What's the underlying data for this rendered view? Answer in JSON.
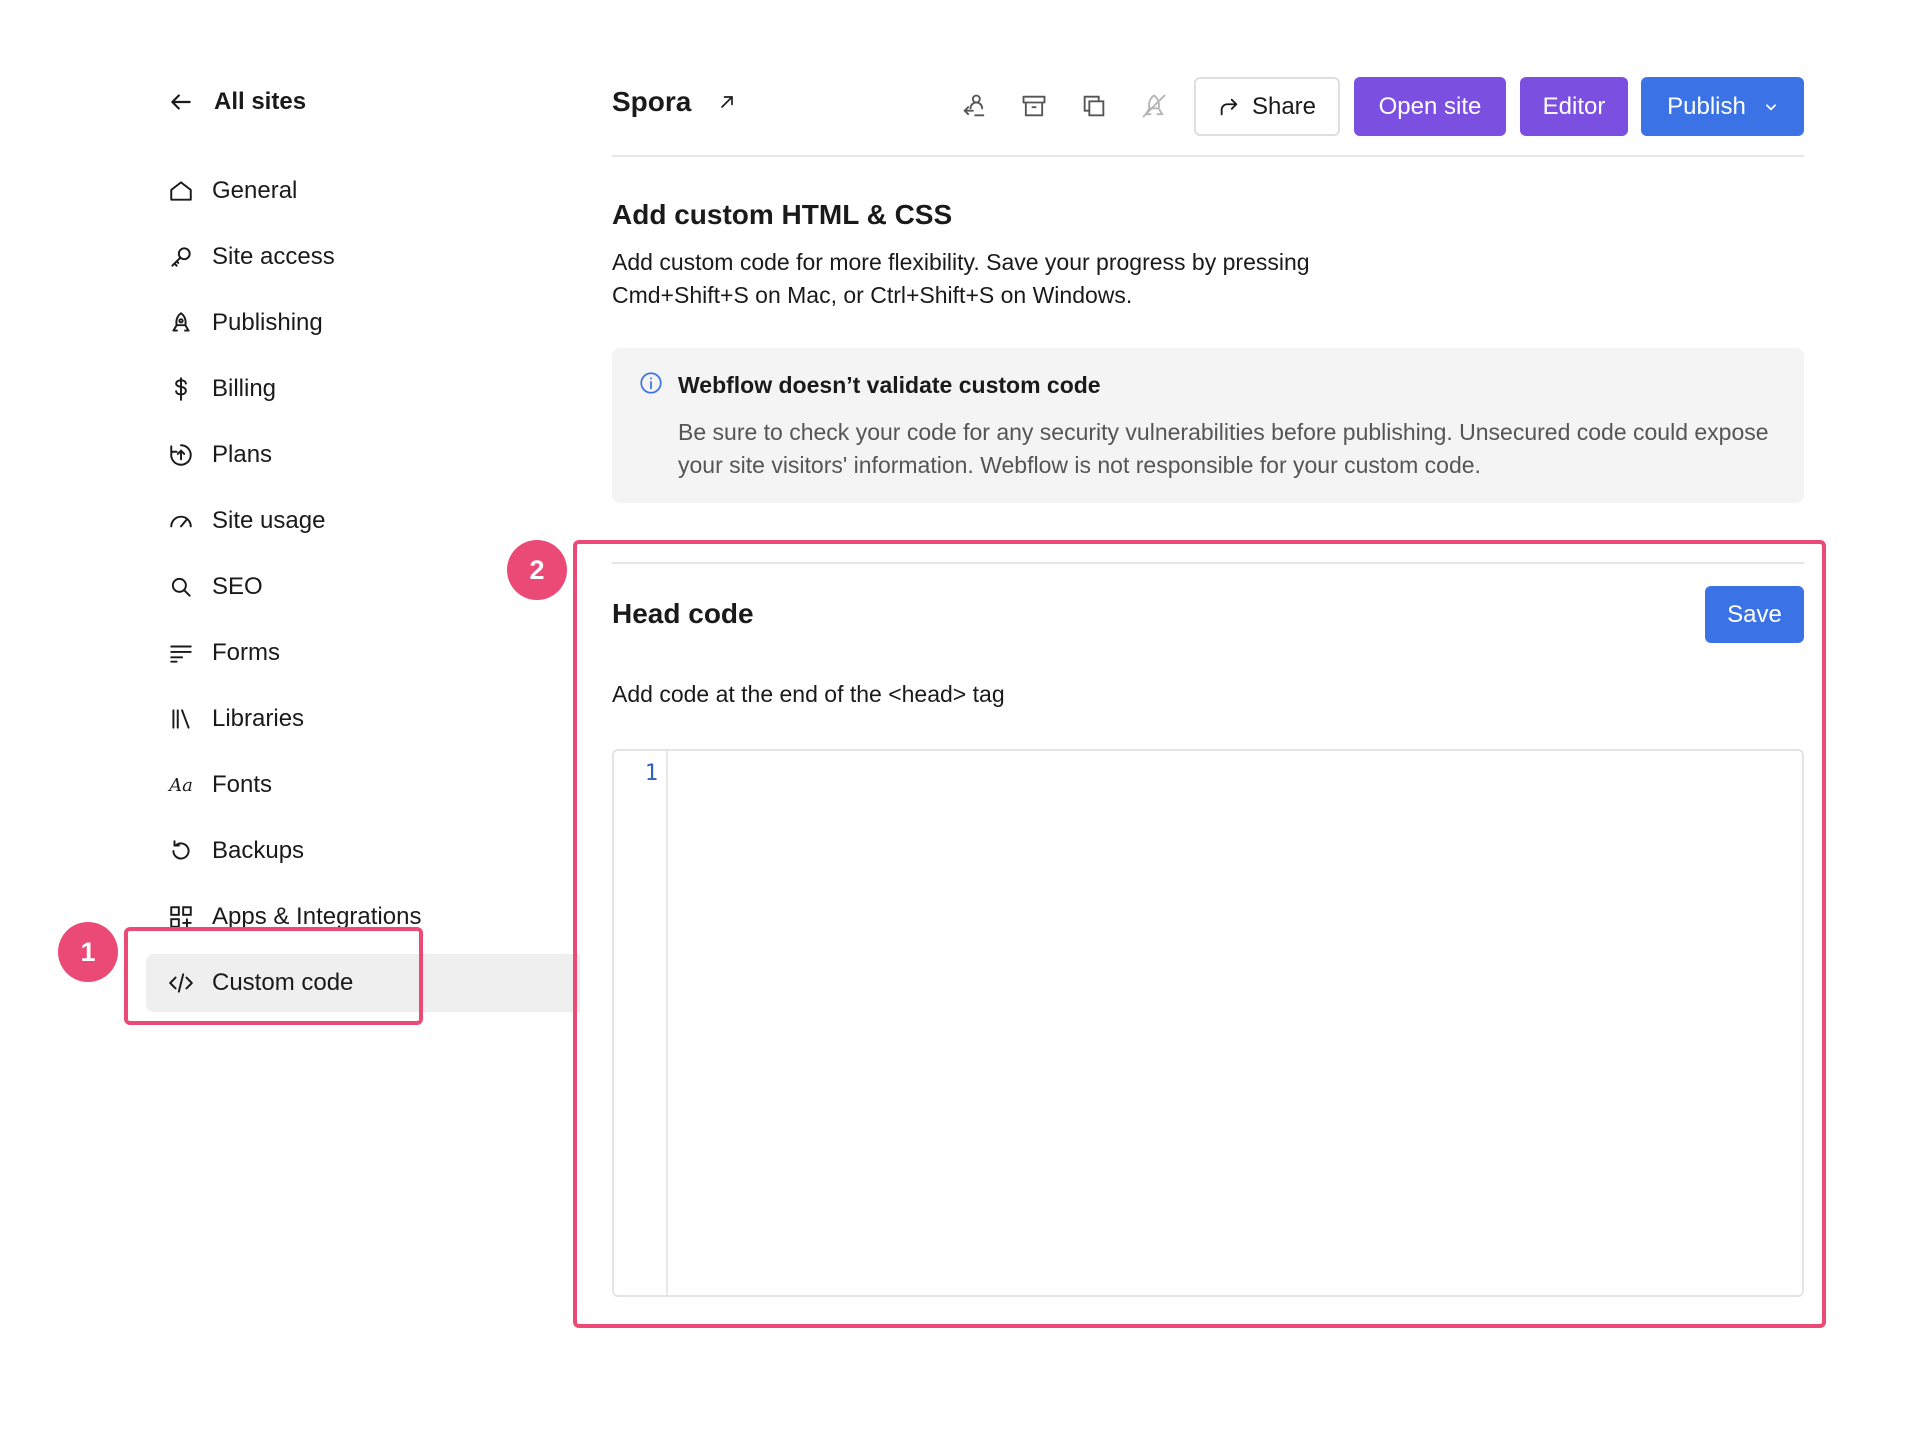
{
  "sidebar": {
    "back_label": "All sites",
    "items": [
      {
        "label": "General",
        "icon": "home-icon"
      },
      {
        "label": "Site access",
        "icon": "key-icon"
      },
      {
        "label": "Publishing",
        "icon": "rocket-icon"
      },
      {
        "label": "Billing",
        "icon": "dollar-icon"
      },
      {
        "label": "Plans",
        "icon": "plans-icon"
      },
      {
        "label": "Site usage",
        "icon": "gauge-icon"
      },
      {
        "label": "SEO",
        "icon": "search-icon"
      },
      {
        "label": "Forms",
        "icon": "forms-icon"
      },
      {
        "label": "Libraries",
        "icon": "libraries-icon"
      },
      {
        "label": "Fonts",
        "icon": "fonts-icon"
      },
      {
        "label": "Backups",
        "icon": "backup-icon"
      },
      {
        "label": "Apps & Integrations",
        "icon": "apps-icon"
      },
      {
        "label": "Custom code",
        "icon": "code-icon",
        "active": true
      }
    ]
  },
  "header": {
    "site_name": "Spora",
    "share_label": "Share",
    "open_site_label": "Open site",
    "editor_label": "Editor",
    "publish_label": "Publish"
  },
  "intro": {
    "title": "Add custom HTML & CSS",
    "description": "Add custom code for more flexibility. Save your progress by pressing Cmd+Shift+S on Mac, or Ctrl+Shift+S on Windows."
  },
  "warning": {
    "title": "Webflow doesn’t validate custom code",
    "body": "Be sure to check your code for any security vulnerabilities before publishing. Unsecured code could expose your site visitors' information. Webflow is not responsible for your custom code."
  },
  "head_code": {
    "title": "Head code",
    "save_label": "Save",
    "description": "Add code at the end of the <head> tag",
    "line_numbers": [
      "1"
    ]
  },
  "annotations": {
    "badge_1": "1",
    "badge_2": "2"
  },
  "colors": {
    "accent_purple": "#7b4fe0",
    "accent_blue": "#3b73e6",
    "highlight_pink": "#ec4a76"
  }
}
